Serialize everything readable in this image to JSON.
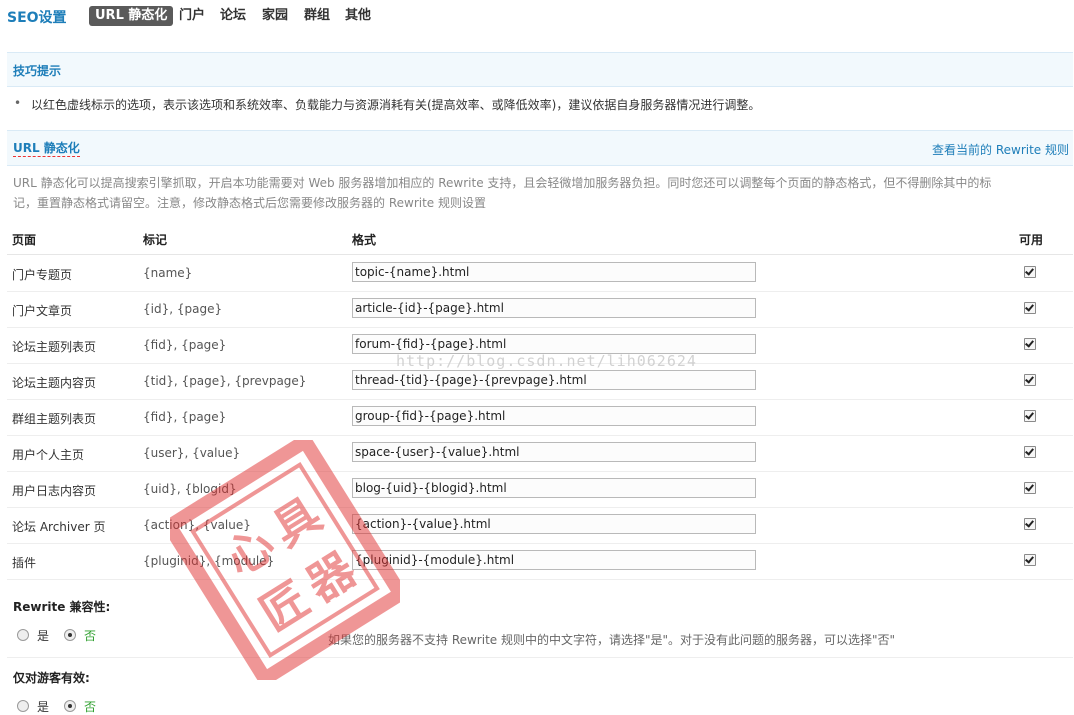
{
  "nav": {
    "brand": "SEO设置",
    "tabs": [
      {
        "label": "URL 静态化",
        "active": true
      },
      {
        "label": "门户"
      },
      {
        "label": "论坛"
      },
      {
        "label": "家园"
      },
      {
        "label": "群组"
      },
      {
        "label": "其他"
      }
    ]
  },
  "tips": {
    "title": "技巧提示",
    "bullet": "•",
    "text": "以红色虚线标示的选项，表示该选项和系统效率、负载能力与资源消耗有关(提高效率、或降低效率)，建议依据自身服务器情况进行调整。"
  },
  "section": {
    "title": "URL 静态化",
    "rewrite_link": "查看当前的 Rewrite 规则",
    "description": "URL 静态化可以提高搜索引擎抓取，开启本功能需要对 Web 服务器增加相应的 Rewrite 支持，且会轻微增加服务器负担。同时您还可以调整每个页面的静态格式，但不得删除其中的标记，重置静态格式请留空。注意，修改静态格式后您需要修改服务器的 Rewrite 规则设置"
  },
  "table": {
    "headers": {
      "page": "页面",
      "mark": "标记",
      "format": "格式",
      "enabled": "可用"
    },
    "rows": [
      {
        "page": "门户专题页",
        "mark": "{name}",
        "format": "topic-{name}.html",
        "enabled": true
      },
      {
        "page": "门户文章页",
        "mark": "{id}, {page}",
        "format": "article-{id}-{page}.html",
        "enabled": true
      },
      {
        "page": "论坛主题列表页",
        "mark": "{fid}, {page}",
        "format": "forum-{fid}-{page}.html",
        "enabled": true
      },
      {
        "page": "论坛主题内容页",
        "mark": "{tid}, {page}, {prevpage}",
        "format": "thread-{tid}-{page}-{prevpage}.html",
        "enabled": true
      },
      {
        "page": "群组主题列表页",
        "mark": "{fid}, {page}",
        "format": "group-{fid}-{page}.html",
        "enabled": true
      },
      {
        "page": "用户个人主页",
        "mark": "{user}, {value}",
        "format": "space-{user}-{value}.html",
        "enabled": true
      },
      {
        "page": "用户日志内容页",
        "mark": "{uid}, {blogid}",
        "format": "blog-{uid}-{blogid}.html",
        "enabled": true
      },
      {
        "page": "论坛 Archiver 页",
        "mark": "{action}, {value}",
        "format": "{action}-{value}.html",
        "enabled": true
      },
      {
        "page": "插件",
        "mark": "{pluginid}, {module}",
        "format": "{pluginid}-{module}.html",
        "enabled": true
      }
    ]
  },
  "options": {
    "compat": {
      "title": "Rewrite 兼容性:",
      "yes_label": "是",
      "no_label": "否",
      "selected": "否",
      "hint": "如果您的服务器不支持 Rewrite 规则中的中文字符，请选择\"是\"。对于没有此问题的服务器，可以选择\"否\""
    },
    "guest_only": {
      "title": "仅对游客有效:",
      "yes_label": "是",
      "no_label": "否",
      "selected": "否"
    }
  },
  "watermark": {
    "url_text": "http://blog.csdn.net/lih062624",
    "stamp_chars": [
      "匠",
      "心",
      "器",
      "具"
    ]
  },
  "colors": {
    "accent": "#1e7eb9",
    "stamp": "#e03030",
    "selected_radio": "#2d9f2d"
  }
}
